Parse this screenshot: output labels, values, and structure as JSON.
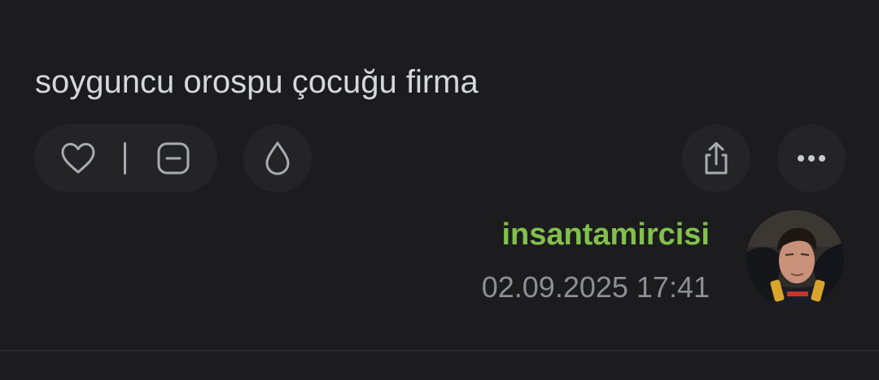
{
  "entry": {
    "text": "soyguncu orospu çocuğu firma"
  },
  "actions": {
    "like_icon": "heart-icon",
    "dislike_icon": "minus-square-icon",
    "drop_icon": "drop-icon",
    "share_icon": "share-icon",
    "more_icon": "more-icon"
  },
  "author": {
    "name": "insantamircisi",
    "date": "02.09.2025 17:41",
    "name_color": "#81c14b"
  },
  "colors": {
    "background": "#1c1c1e",
    "button_bg": "#242427",
    "icon": "#a9abb0",
    "text": "#d6d7da",
    "date": "#8d8f95"
  }
}
